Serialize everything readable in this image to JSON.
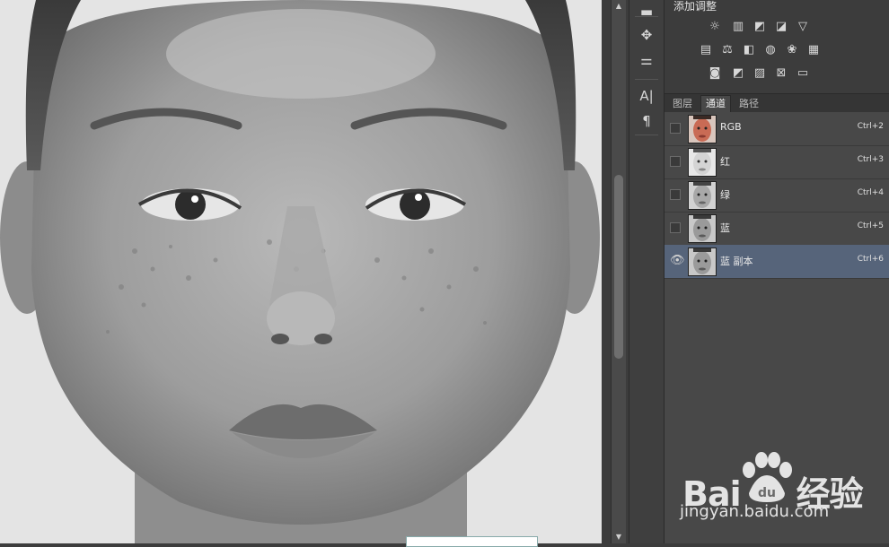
{
  "adjustments": {
    "title": "添加调整",
    "row1": [
      "brightness-icon",
      "levels-icon",
      "curves-icon",
      "exposure-icon",
      "vibrance-icon"
    ],
    "row2": [
      "hue-saturation-icon",
      "color-balance-icon",
      "black-white-icon",
      "photo-filter-icon",
      "channel-mixer-icon",
      "color-lookup-icon"
    ],
    "row3": [
      "invert-icon",
      "posterize-icon",
      "threshold-icon",
      "selective-color-icon",
      "gradient-map-icon"
    ]
  },
  "tabs": {
    "layers": "图层",
    "channels": "通道",
    "paths": "路径"
  },
  "channels": [
    {
      "name": "RGB",
      "shortcut": "Ctrl+2",
      "visible": false,
      "thumb": "color"
    },
    {
      "name": "红",
      "shortcut": "Ctrl+3",
      "visible": false,
      "thumb": "light"
    },
    {
      "name": "绿",
      "shortcut": "Ctrl+4",
      "visible": false,
      "thumb": "mid"
    },
    {
      "name": "蓝",
      "shortcut": "Ctrl+5",
      "visible": false,
      "thumb": "dark"
    },
    {
      "name": "蓝 副本",
      "shortcut": "Ctrl+6",
      "visible": true,
      "thumb": "dark"
    }
  ],
  "watermark": {
    "brand": "Bai",
    "brand_tail": "经验",
    "paw_text": "du",
    "url": "jingyan.baidu.com"
  },
  "colors": {
    "panel": "#484848",
    "selected_row": "#56647a",
    "canvas_bg": "#e6e6e6"
  }
}
